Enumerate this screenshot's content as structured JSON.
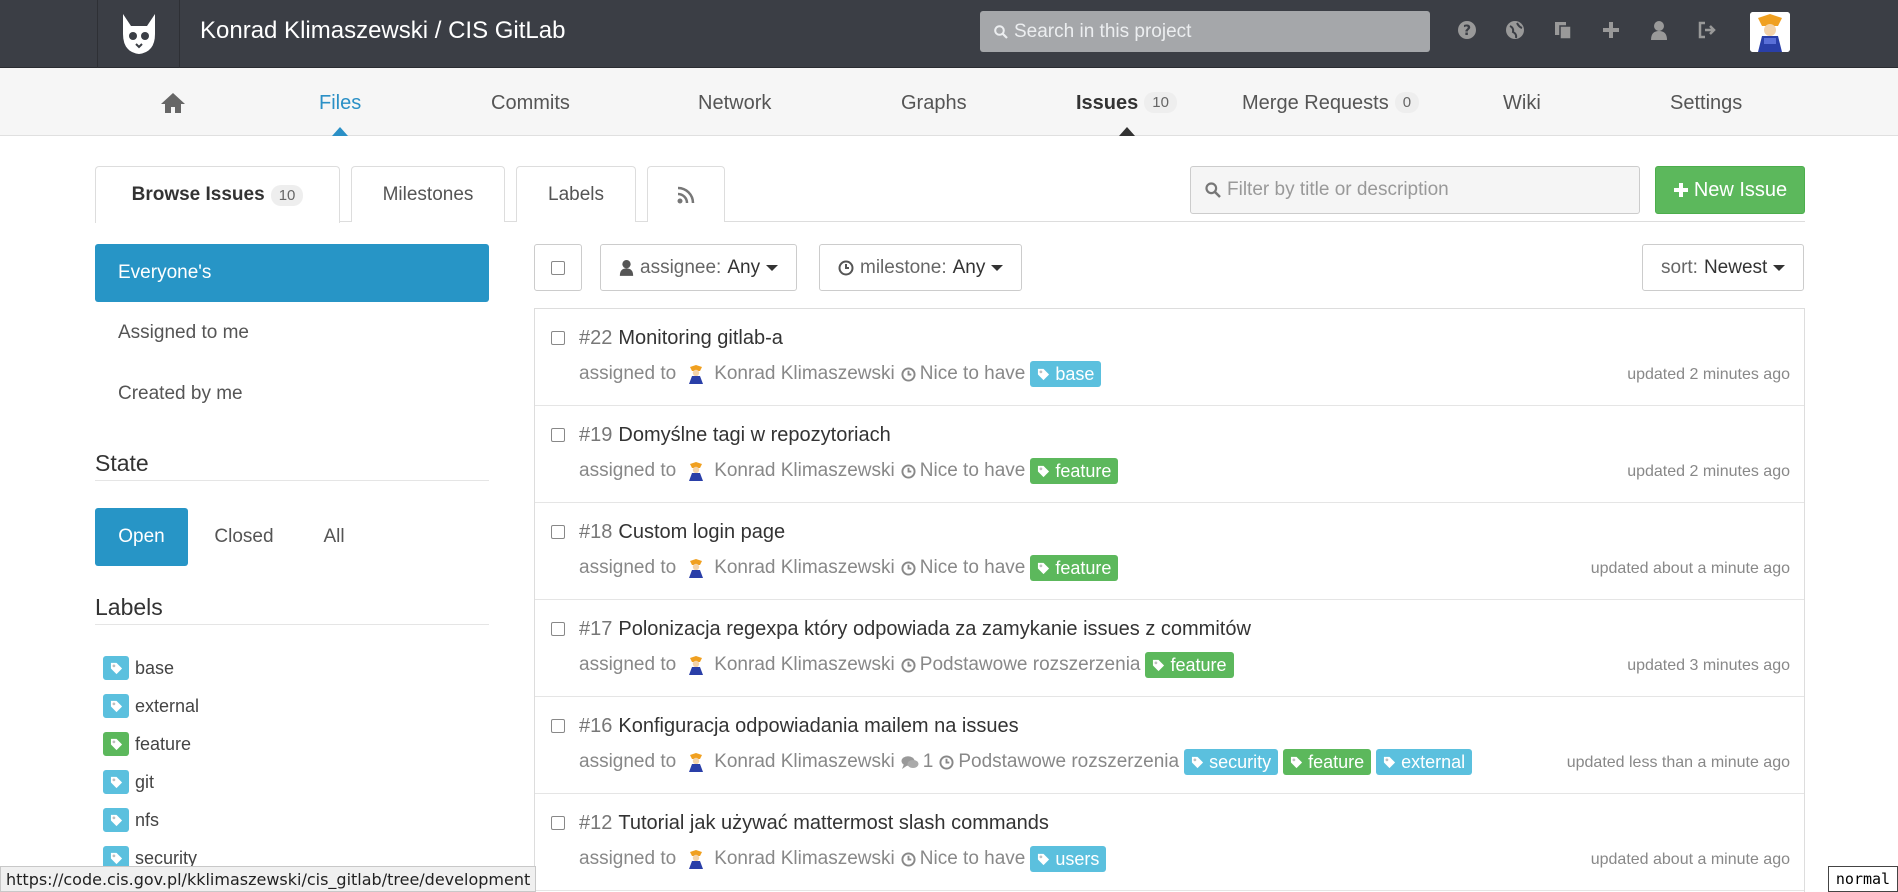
{
  "header": {
    "title": "Konrad Klimaszewski / CIS GitLab",
    "search_placeholder": "Search in this project",
    "icons": [
      "help-icon",
      "globe-icon",
      "snippets-icon",
      "plus-icon",
      "user-icon",
      "sign-out-icon"
    ]
  },
  "nav": {
    "items": [
      "Files",
      "Commits",
      "Network",
      "Graphs",
      "Issues",
      "Merge Requests",
      "Wiki",
      "Settings"
    ],
    "issues_count": "10",
    "mr_count": "0",
    "active": "Files"
  },
  "tabs": {
    "browse": "Browse Issues",
    "browse_count": "10",
    "milestones": "Milestones",
    "labels": "Labels"
  },
  "filter": {
    "placeholder": "Filter by title or description",
    "new_issue": "New Issue"
  },
  "sidebar": {
    "scopes": [
      "Everyone's",
      "Assigned to me",
      "Created by me"
    ],
    "state_title": "State",
    "states": [
      "Open",
      "Closed",
      "All"
    ],
    "labels_title": "Labels",
    "labels": [
      {
        "name": "base",
        "color": "#5bc0de"
      },
      {
        "name": "external",
        "color": "#5bc0de"
      },
      {
        "name": "feature",
        "color": "#5cb85c"
      },
      {
        "name": "git",
        "color": "#5bc0de"
      },
      {
        "name": "nfs",
        "color": "#5bc0de"
      },
      {
        "name": "security",
        "color": "#5bc0de"
      }
    ]
  },
  "filters": {
    "assignee_label": "assignee:",
    "assignee_value": "Any",
    "milestone_label": "milestone:",
    "milestone_value": "Any",
    "sort_label": "sort:",
    "sort_value": "Newest"
  },
  "issues": [
    {
      "num": "#22",
      "title": "Monitoring gitlab-a",
      "assigned": "assigned to",
      "assignee": "Konrad Klimaszewski",
      "comments": "",
      "milestone": "Nice to have",
      "labels": [
        {
          "name": "base",
          "color": "#5bc0de"
        }
      ],
      "updated": "updated 2 minutes ago"
    },
    {
      "num": "#19",
      "title": "Domyślne tagi w repozytoriach",
      "assigned": "assigned to",
      "assignee": "Konrad Klimaszewski",
      "comments": "",
      "milestone": "Nice to have",
      "labels": [
        {
          "name": "feature",
          "color": "#5cb85c"
        }
      ],
      "updated": "updated 2 minutes ago"
    },
    {
      "num": "#18",
      "title": "Custom login page",
      "assigned": "assigned to",
      "assignee": "Konrad Klimaszewski",
      "comments": "",
      "milestone": "Nice to have",
      "labels": [
        {
          "name": "feature",
          "color": "#5cb85c"
        }
      ],
      "updated": "updated about a minute ago"
    },
    {
      "num": "#17",
      "title": "Polonizacja regexpa który odpowiada za zamykanie issues z commitów",
      "assigned": "assigned to",
      "assignee": "Konrad Klimaszewski",
      "comments": "",
      "milestone": "Podstawowe rozszerzenia",
      "labels": [
        {
          "name": "feature",
          "color": "#5cb85c"
        }
      ],
      "updated": "updated 3 minutes ago"
    },
    {
      "num": "#16",
      "title": "Konfiguracja odpowiadania mailem na issues",
      "assigned": "assigned to",
      "assignee": "Konrad Klimaszewski",
      "comments": "1",
      "milestone": "Podstawowe rozszerzenia",
      "labels": [
        {
          "name": "security",
          "color": "#5bc0de"
        },
        {
          "name": "feature",
          "color": "#5cb85c"
        },
        {
          "name": "external",
          "color": "#5bc0de"
        }
      ],
      "updated": "updated less than a minute ago"
    },
    {
      "num": "#12",
      "title": "Tutorial jak używać mattermost slash commands",
      "assigned": "assigned to",
      "assignee": "Konrad Klimaszewski",
      "comments": "",
      "milestone": "Nice to have",
      "labels": [
        {
          "name": "users",
          "color": "#5bc0de"
        }
      ],
      "updated": "updated about a minute ago"
    }
  ],
  "statusbar": {
    "url": "https://code.cis.gov.pl/kklimaszewski/cis_gitlab/tree/development",
    "mode": "normal"
  }
}
